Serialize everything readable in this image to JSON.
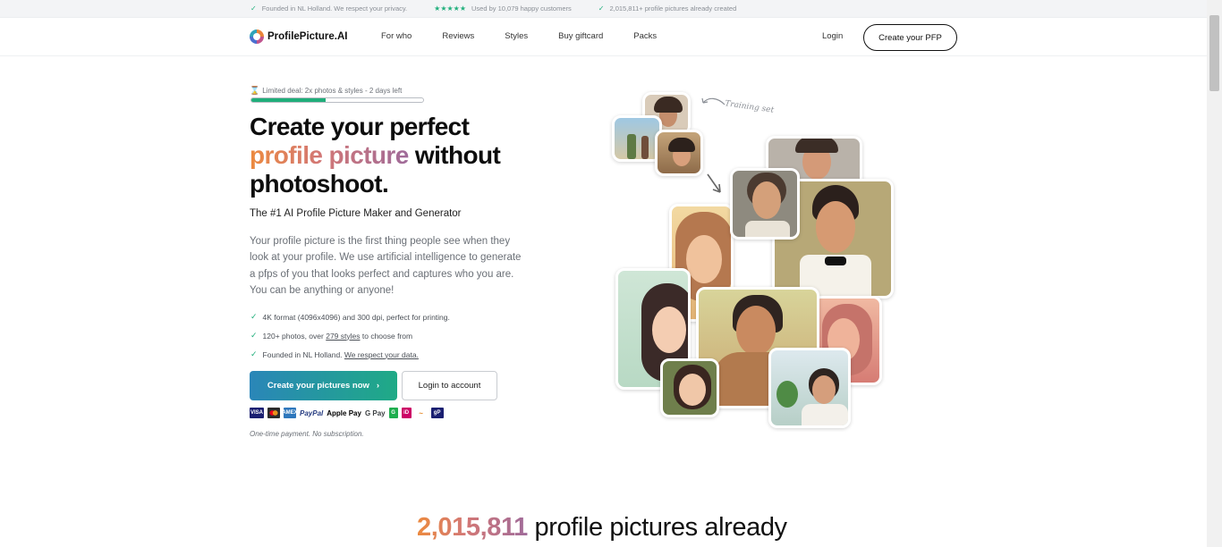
{
  "topbar": {
    "founded": "Founded in NL Holland. We respect your privacy.",
    "stars": "★★★★★",
    "customers": "Used by 10,079 happy customers",
    "created": "2,015,811+ profile pictures already created"
  },
  "nav": {
    "logo": "ProfilePicture.AI",
    "items": [
      "For who",
      "Reviews",
      "Styles",
      "Buy giftcard",
      "Packs"
    ],
    "login": "Login",
    "cta": "Create your PFP"
  },
  "hero": {
    "deal": "Limited deal: 2x photos & styles - 2 days left",
    "deal_progress": 0.43,
    "title_pre": "Create your perfect",
    "title_grad": "profile picture",
    "title_post": "without",
    "title_end": "photoshoot.",
    "subtitle": "The #1 AI Profile Picture Maker and Generator",
    "description": "Your profile picture is the first thing people see when they look at your profile. We use artificial intelligence to generate a pfps of you that looks perfect and captures who you are. You can be anything or anyone!",
    "bullets": {
      "b1": "4K format (4096x4096) and 300 dpi, perfect for printing.",
      "b2_pre": "120+ photos, over",
      "b2_link": "279 styles",
      "b2_post": "to choose from",
      "b3_pre": "Founded in NL Holland.",
      "b3_link": "We respect your data."
    },
    "primary_button": "Create your pictures now",
    "primary_chevron": "›",
    "secondary_button": "Login to account",
    "payments": [
      "VISA",
      "MC",
      "AMEX",
      "PayPal",
      "Apple Pay",
      "G Pay",
      "G",
      "iD",
      "~",
      "gP"
    ],
    "note": "One-time payment. No subscription.",
    "training_label": "Training set"
  },
  "stats": {
    "number": "2,015,811",
    "text": "profile pictures already"
  },
  "colors": {
    "accent_green": "#1fae7a",
    "gradient_start": "#ec8a3f",
    "gradient_end": "#9f6b9a",
    "primary_button_start": "#2a86b8",
    "primary_button_end": "#1faa86"
  }
}
